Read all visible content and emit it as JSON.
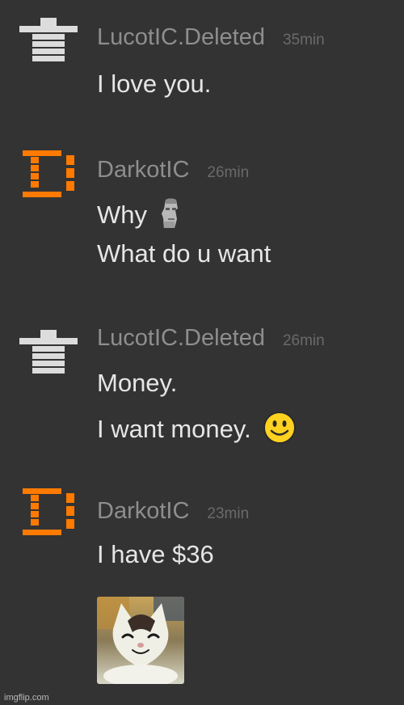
{
  "messages": [
    {
      "author": "LucotIC.Deleted",
      "time": "35min",
      "lines": [
        "I love you."
      ]
    },
    {
      "author": "DarkotIC",
      "time": "26min",
      "lines": [
        "Why",
        "What do u want"
      ]
    },
    {
      "author": "LucotIC.Deleted",
      "time": "26min",
      "lines": [
        "Money.",
        "I want money."
      ]
    },
    {
      "author": "DarkotIC",
      "time": "23min",
      "lines": [
        "I have $36"
      ]
    }
  ],
  "icons": {
    "user_grey_avatar": "grey-pillar-avatar-icon",
    "user_orange_avatar": "orange-d-avatar-icon",
    "moai": "moai-emoji-icon",
    "smile": "smiling-face-emoji-icon",
    "attachment": "smiling-cat-image"
  },
  "colors": {
    "background": "#333333",
    "username": "#8e8e8e",
    "timestamp": "#6a6a6a",
    "message_text": "#e6e6e6",
    "grey_avatar": "#dcdcdc",
    "orange_avatar": "#ff7a00"
  },
  "watermark": "imgflip.com"
}
